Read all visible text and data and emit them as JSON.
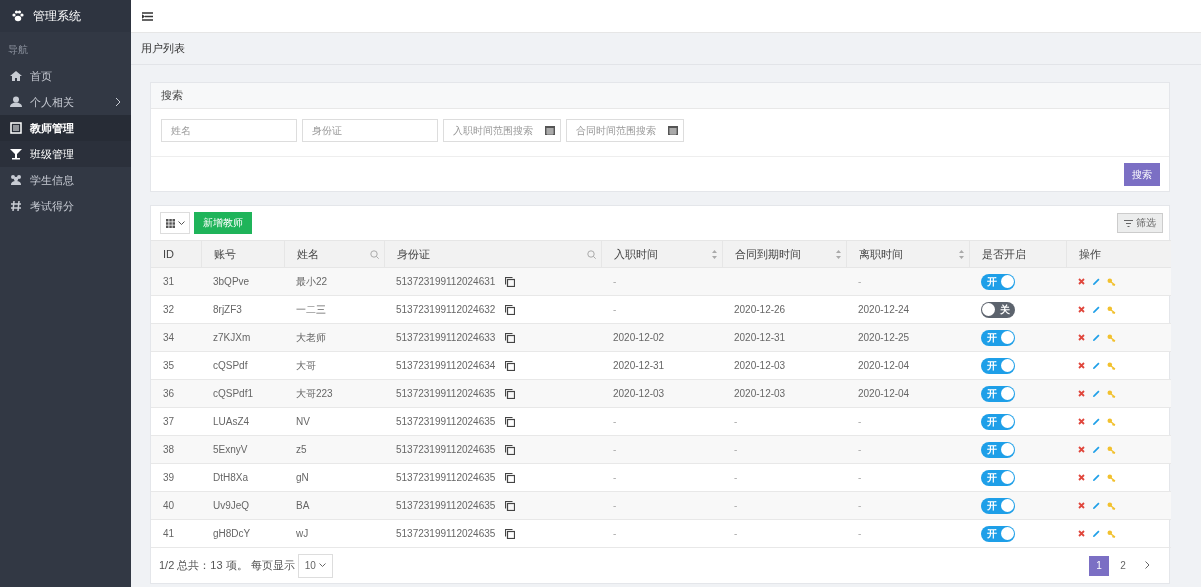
{
  "sidebar": {
    "brand": "管理系统",
    "section_label": "导航",
    "items": [
      {
        "label": "首页",
        "selected": false,
        "hovered": false,
        "has_children": false
      },
      {
        "label": "个人相关",
        "selected": false,
        "hovered": false,
        "has_children": true
      },
      {
        "label": "教师管理",
        "selected": true,
        "hovered": false,
        "has_children": false
      },
      {
        "label": "班级管理",
        "selected": false,
        "hovered": true,
        "has_children": false
      },
      {
        "label": "学生信息",
        "selected": false,
        "hovered": false,
        "has_children": false
      },
      {
        "label": "考试得分",
        "selected": false,
        "hovered": false,
        "has_children": false
      }
    ]
  },
  "breadcrumb": "用户列表",
  "search": {
    "title": "搜索",
    "fields": [
      {
        "placeholder": "姓名",
        "kind": "text"
      },
      {
        "placeholder": "身份证",
        "kind": "text"
      },
      {
        "placeholder": "入职时间范围搜索",
        "kind": "date"
      },
      {
        "placeholder": "合同时间范围搜索",
        "kind": "date"
      }
    ],
    "button": "搜索"
  },
  "toolbar": {
    "add_button": "新增教师",
    "filter_button": "筛选"
  },
  "table": {
    "columns": [
      {
        "label": "ID"
      },
      {
        "label": "账号"
      },
      {
        "label": "姓名",
        "searchable": true
      },
      {
        "label": "身份证",
        "searchable": true
      },
      {
        "label": "入职时间",
        "sortable": true
      },
      {
        "label": "合同到期时间",
        "sortable": true
      },
      {
        "label": "离职时间",
        "sortable": true
      },
      {
        "label": "是否开启"
      },
      {
        "label": "操作"
      }
    ],
    "rows": [
      {
        "id": "31",
        "account": "3bQPve",
        "name": "最小22",
        "id_card": "513723199112024631",
        "hire_date": "-",
        "leave_date": "-",
        "enabled": true,
        "toggle_label": "开"
      },
      {
        "id": "32",
        "account": "8rjZF3",
        "name": "一二三",
        "id_card": "513723199112024632",
        "hire_date": "-",
        "contract_end": "2020-12-26",
        "leave_date": "2020-12-24",
        "enabled": false,
        "toggle_label": "关"
      },
      {
        "id": "34",
        "account": "z7KJXm",
        "name": "大老师",
        "id_card": "513723199112024633",
        "hire_date": "2020-12-02",
        "contract_end": "2020-12-31",
        "leave_date": "2020-12-25",
        "enabled": true,
        "toggle_label": "开"
      },
      {
        "id": "35",
        "account": "cQSPdf",
        "name": "大哥",
        "id_card": "513723199112024634",
        "hire_date": "2020-12-31",
        "contract_end": "2020-12-03",
        "leave_date": "2020-12-04",
        "enabled": true,
        "toggle_label": "开"
      },
      {
        "id": "36",
        "account": "cQSPdf1",
        "name": "大哥223",
        "id_card": "513723199112024635",
        "hire_date": "2020-12-03",
        "contract_end": "2020-12-03",
        "leave_date": "2020-12-04",
        "enabled": true,
        "toggle_label": "开"
      },
      {
        "id": "37",
        "account": "LUAsZ4",
        "name": "NV",
        "id_card": "513723199112024635",
        "hire_date": "-",
        "contract_end": "-",
        "leave_date": "-",
        "enabled": true,
        "toggle_label": "开"
      },
      {
        "id": "38",
        "account": "5ExnyV",
        "name": "z5",
        "id_card": "513723199112024635",
        "hire_date": "-",
        "contract_end": "-",
        "leave_date": "-",
        "enabled": true,
        "toggle_label": "开"
      },
      {
        "id": "39",
        "account": "DtH8Xa",
        "name": "gN",
        "id_card": "513723199112024635",
        "hire_date": "-",
        "contract_end": "-",
        "leave_date": "-",
        "enabled": true,
        "toggle_label": "开"
      },
      {
        "id": "40",
        "account": "Uv9JeQ",
        "name": "BA",
        "id_card": "513723199112024635",
        "hire_date": "-",
        "contract_end": "-",
        "leave_date": "-",
        "enabled": true,
        "toggle_label": "开"
      },
      {
        "id": "41",
        "account": "gH8DcY",
        "name": "wJ",
        "id_card": "513723199112024635",
        "hire_date": "-",
        "contract_end": "-",
        "leave_date": "-",
        "enabled": true,
        "toggle_label": "开"
      }
    ]
  },
  "footer": {
    "summary": "1/2 总共：13 项。 每页显示",
    "page_size": "10",
    "pages": [
      {
        "label": "1",
        "selected": true
      },
      {
        "label": "2",
        "selected": false
      }
    ]
  }
}
